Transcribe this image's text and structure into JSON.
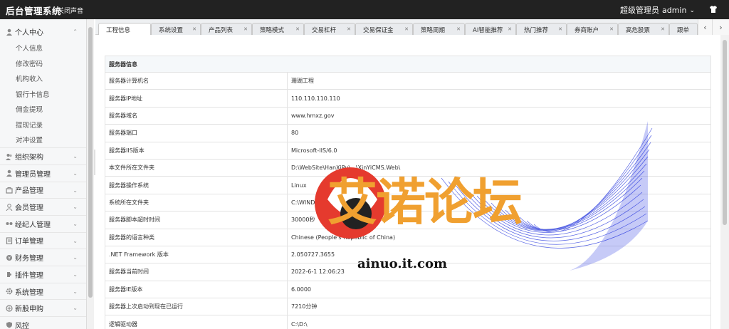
{
  "topbar": {
    "brand": "后台管理系统",
    "mute": "关闭声音",
    "role": "超级管理员",
    "user": "admin"
  },
  "sidebar": {
    "groups": [
      {
        "label": "个人中心",
        "icon": "user-icon",
        "open": true,
        "items": [
          "个人信息",
          "修改密码",
          "机构收入",
          "银行卡信息",
          "佣金提现",
          "提现记录",
          "对冲设置"
        ]
      },
      {
        "label": "组织架构",
        "icon": "org-icon"
      },
      {
        "label": "管理员管理",
        "icon": "admin-icon"
      },
      {
        "label": "产品管理",
        "icon": "product-icon"
      },
      {
        "label": "会员管理",
        "icon": "member-icon"
      },
      {
        "label": "经纪人管理",
        "icon": "broker-icon"
      },
      {
        "label": "订单管理",
        "icon": "order-icon"
      },
      {
        "label": "财务管理",
        "icon": "finance-icon"
      },
      {
        "label": "插件管理",
        "icon": "plugin-icon"
      },
      {
        "label": "系统管理",
        "icon": "system-icon"
      },
      {
        "label": "新股申购",
        "icon": "ipo-icon"
      },
      {
        "label": "风控",
        "icon": "risk-icon"
      }
    ]
  },
  "tabs": [
    "工程信息",
    "系统设置",
    "产品列表",
    "策略模式",
    "交易杠杆",
    "交易保证金",
    "策略周期",
    "AI智能推荐",
    "热门推荐",
    "券商账户",
    "高危股票",
    "跟单"
  ],
  "table": {
    "title": "服务器信息",
    "rows": [
      {
        "k": "服务器计算机名",
        "v": "珊瑚工程"
      },
      {
        "k": "服务器IP地址",
        "v": "110.110.110.110"
      },
      {
        "k": "服务器域名",
        "v": "www.hmxz.gov"
      },
      {
        "k": "服务器端口",
        "v": "80"
      },
      {
        "k": "服务器IIS版本",
        "v": "Microsoft-IIS/6.0"
      },
      {
        "k": "本文件所在文件夹",
        "v": "D:\\WebSite\\HanXiPu\\...\\XinYiCMS.Web\\"
      },
      {
        "k": "服务器操作系统",
        "v": "Linux"
      },
      {
        "k": "系统所在文件夹",
        "v": "C:\\WINDOWS\\system32"
      },
      {
        "k": "服务器脚本超时时间",
        "v": "30000秒"
      },
      {
        "k": "服务器的语言种类",
        "v": "Chinese (People's Republic of China)"
      },
      {
        "k": ".NET Framework 版本",
        "v": "2.050727.3655"
      },
      {
        "k": "服务器当前时间",
        "v": "2022-6-1 12:06:23"
      },
      {
        "k": "服务器IE版本",
        "v": "6.0000"
      },
      {
        "k": "服务器上次启动到现在已运行",
        "v": "7210分钟"
      },
      {
        "k": "逻辑驱动器",
        "v": "C:\\D:\\"
      }
    ]
  },
  "watermark": {
    "text": "艾诺论坛",
    "url": "ainuo.it.com",
    "colors": {
      "text": "#f0a030",
      "logo_red": "#e53a2e",
      "logo_black": "#222222",
      "wave": "#2233dd"
    }
  }
}
